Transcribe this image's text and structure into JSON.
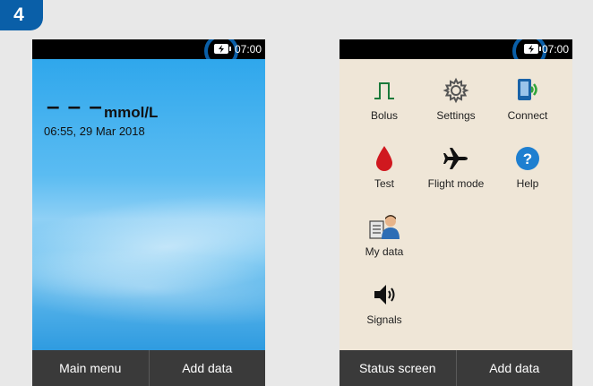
{
  "step_number": "4",
  "colors": {
    "accent": "#0a5fa8",
    "bottom_bar": "#3a3a3a",
    "menu_background": "#efe6d7"
  },
  "left_device": {
    "status_bar": {
      "time": "07:00",
      "battery_icon": "battery-charging-icon"
    },
    "reading": {
      "value": "– – –",
      "unit": "mmol/L",
      "datetime": "06:55, 29 Mar 2018"
    },
    "bottom_bar": {
      "left_label": "Main menu",
      "right_label": "Add data"
    }
  },
  "right_device": {
    "status_bar": {
      "time": "07:00",
      "battery_icon": "battery-charging-icon"
    },
    "menu_items": [
      {
        "label": "Bolus",
        "icon": "bolus-icon"
      },
      {
        "label": "Settings",
        "icon": "gear-icon"
      },
      {
        "label": "Connect",
        "icon": "connect-icon"
      },
      {
        "label": "Test",
        "icon": "blood-drop-icon"
      },
      {
        "label": "Flight mode",
        "icon": "airplane-icon"
      },
      {
        "label": "Help",
        "icon": "help-icon"
      },
      {
        "label": "My data",
        "icon": "my-data-icon"
      },
      {
        "label": "Signals",
        "icon": "speaker-icon"
      }
    ],
    "bottom_bar": {
      "left_label": "Status screen",
      "right_label": "Add data"
    }
  }
}
